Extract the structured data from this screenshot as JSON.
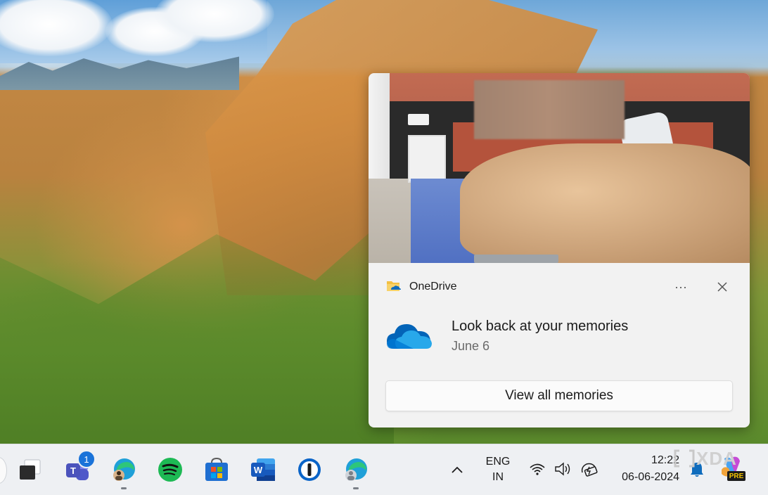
{
  "notification": {
    "app_name": "OneDrive",
    "more_label": "···",
    "title": "Look back at your memories",
    "subtitle": "June 6",
    "action_label": "View all memories"
  },
  "taskbar": {
    "teams_badge": "1",
    "language_line1": "ENG",
    "language_line2": "IN",
    "time": "12:22",
    "date": "06-06-2024",
    "pre_label": "PRE"
  },
  "watermark": {
    "text": "XDA"
  },
  "colors": {
    "onedrive_blue": "#0f6cbd",
    "taskbar_bg": "#eef0f3",
    "toast_bg": "#f2f2f2"
  },
  "icons": [
    "onedrive-icon",
    "more-icon",
    "close-icon",
    "onedrive-cloud-icon",
    "task-view-icon",
    "teams-icon",
    "edge-icon",
    "spotify-icon",
    "store-icon",
    "word-icon",
    "onepassword-icon",
    "chevron-up-icon",
    "wifi-icon",
    "volume-icon",
    "battery-icon",
    "bell-icon",
    "copilot-icon"
  ]
}
